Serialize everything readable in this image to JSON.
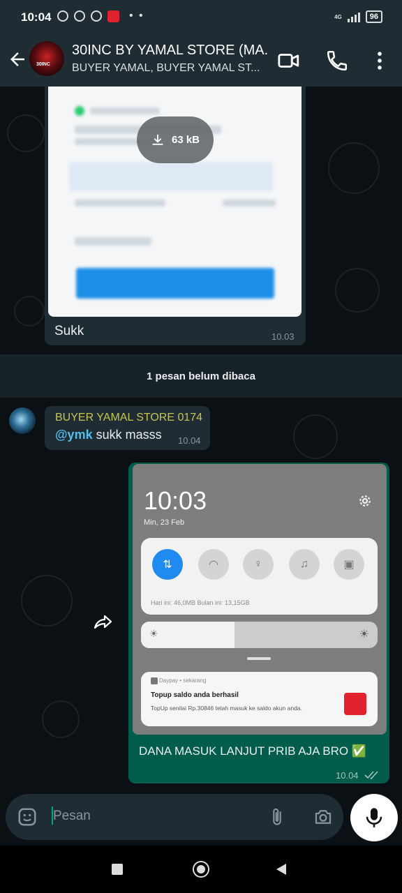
{
  "status_bar": {
    "time": "10:04",
    "network": "4G",
    "battery": "96",
    "icons": [
      "alarm-icon",
      "b-circle-icon",
      "whatsapp-icon",
      "dana-icon",
      "more-dots-icon"
    ]
  },
  "header": {
    "title": "30INC BY YAMAL STORE (MA...",
    "subtitle": "BUYER YAMAL, BUYER YAMAL ST...",
    "avatar_text": "30INC"
  },
  "messages": {
    "first": {
      "download_size": "63 kB",
      "caption": "Sukk",
      "time": "10.03"
    },
    "unread_banner": "1 pesan belum dibaca",
    "incoming": {
      "sender": "BUYER YAMAL STORE 0174",
      "mention": "@ymk",
      "text": " sukk masss",
      "time": "10.04"
    },
    "outgoing": {
      "caption": "DANA MASUK LANJUT PRIB AJA BRO ✅",
      "time": "10.04",
      "screenshot": {
        "clock": "10:03",
        "date": "Min, 23 Feb",
        "usage": "Hari ini: 46,0MB     Bulan ini: 13,15GB",
        "notif_app": "Daypay • sekarang",
        "notif_title": "Topup saldo anda berhasil",
        "notif_body": "TopUp senilai Rp.30846 telah masuk ke saldo akun anda."
      }
    }
  },
  "composer": {
    "placeholder": "Pesan"
  },
  "colors": {
    "app_bar": "#1f2c33",
    "outgoing_bubble": "#005c4b",
    "incoming_bubble": "#1f2c33",
    "accent": "#00a884",
    "sender_name": "#c5c74c"
  }
}
